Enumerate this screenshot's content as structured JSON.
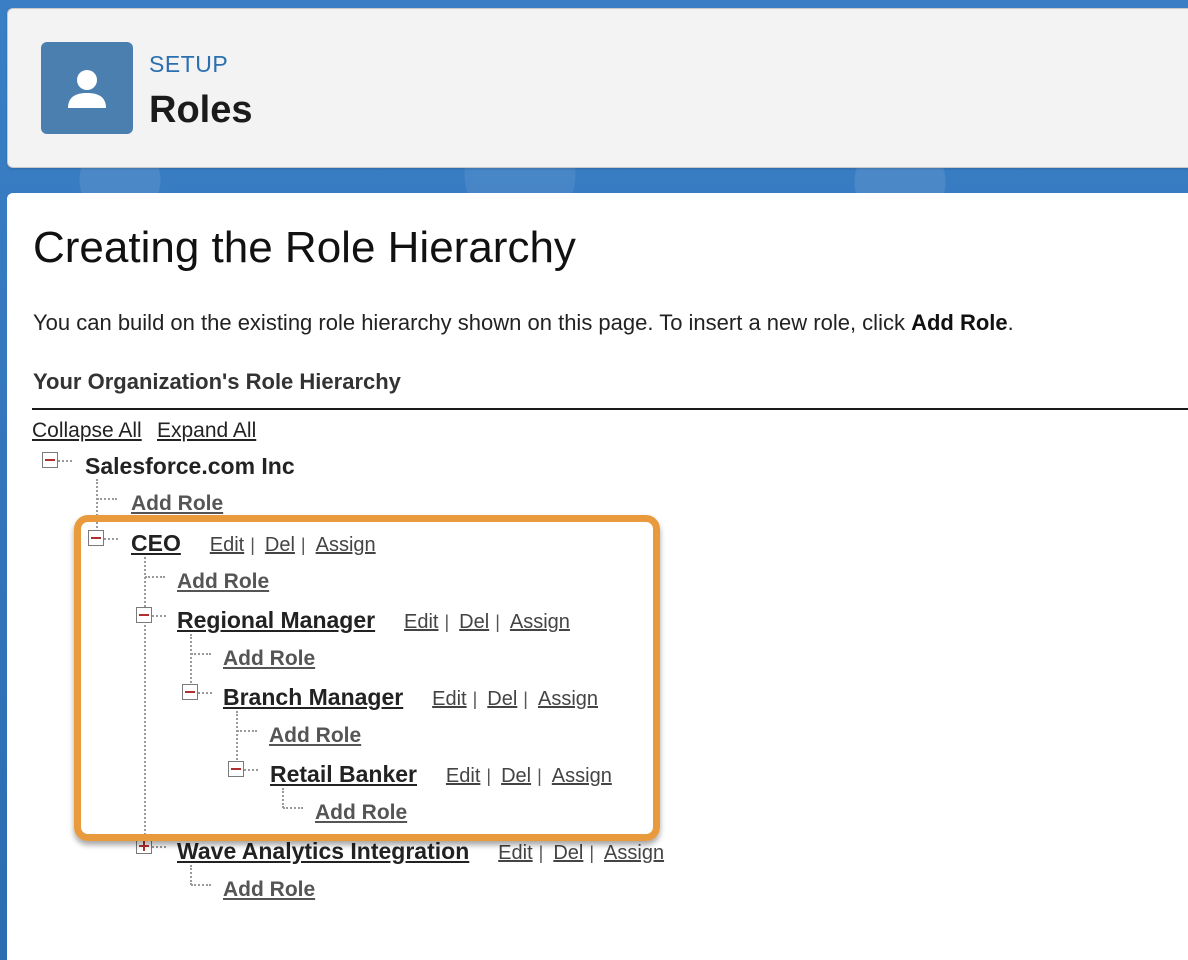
{
  "header": {
    "eyebrow": "SETUP",
    "title": "Roles",
    "icon": "user-icon"
  },
  "content": {
    "title": "Creating the Role Hierarchy",
    "intro_text": "You can build on the existing role hierarchy shown on this page. To insert a new role, click ",
    "intro_bold": "Add Role",
    "intro_end": ".",
    "section_heading": "Your Organization's Role Hierarchy",
    "collapse_all": "Collapse All",
    "expand_all": "Expand All"
  },
  "tree": {
    "root": "Salesforce.com Inc",
    "add_role": "Add Role",
    "actions": {
      "edit": "Edit",
      "del": "Del",
      "assign": "Assign",
      "separator": "|"
    },
    "nodes": [
      {
        "name": "CEO"
      },
      {
        "name": "Regional Manager"
      },
      {
        "name": "Branch Manager"
      },
      {
        "name": "Retail Banker"
      },
      {
        "name": "Wave Analytics Integration"
      }
    ]
  },
  "colors": {
    "highlight": "#e89a3c",
    "accent": "#2a6fb0",
    "icon_bg": "#4a7fb0"
  }
}
